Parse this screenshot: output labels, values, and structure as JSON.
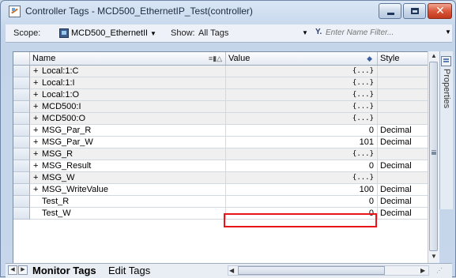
{
  "window": {
    "title": "Controller Tags - MCD500_EthernetIP_Test(controller)",
    "close_glyph": "✕"
  },
  "toolbar": {
    "scope_label": "Scope:",
    "scope_value": "MCD500_EthernetIF",
    "show_label": "Show:",
    "show_value": "All Tags",
    "filter_placeholder": "Enter Name Filter..."
  },
  "grid": {
    "columns": {
      "name": "Name",
      "value": "Value",
      "style": "Style"
    },
    "rows": [
      {
        "expand": "+",
        "name": "Local:1:C",
        "value": "{...}",
        "style": "",
        "struct": true
      },
      {
        "expand": "+",
        "name": "Local:1:I",
        "value": "{...}",
        "style": "",
        "struct": true
      },
      {
        "expand": "+",
        "name": "Local:1:O",
        "value": "{...}",
        "style": "",
        "struct": true
      },
      {
        "expand": "+",
        "name": "MCD500:I",
        "value": "{...}",
        "style": "",
        "struct": true
      },
      {
        "expand": "+",
        "name": "MCD500:O",
        "value": "{...}",
        "style": "",
        "struct": true
      },
      {
        "expand": "+",
        "name": "MSG_Par_R",
        "value": "0",
        "style": "Decimal",
        "struct": false
      },
      {
        "expand": "+",
        "name": "MSG_Par_W",
        "value": "101",
        "style": "Decimal",
        "struct": false
      },
      {
        "expand": "+",
        "name": "MSG_R",
        "value": "{...}",
        "style": "",
        "struct": true
      },
      {
        "expand": "+",
        "name": "MSG_Result",
        "value": "0",
        "style": "Decimal",
        "struct": false
      },
      {
        "expand": "+",
        "name": "MSG_W",
        "value": "{...}",
        "style": "",
        "struct": true
      },
      {
        "expand": "+",
        "name": "MSG_WriteValue",
        "value": "100",
        "style": "Decimal",
        "struct": false,
        "highlighted": true
      },
      {
        "expand": "",
        "name": "Test_R",
        "value": "0",
        "style": "Decimal",
        "struct": false
      },
      {
        "expand": "",
        "name": "Test_W",
        "value": "0",
        "style": "Decimal",
        "struct": false
      }
    ]
  },
  "side_panel": {
    "label": "Properties"
  },
  "tabs": [
    {
      "label": "Monitor Tags",
      "active": true
    },
    {
      "label": "Edit Tags",
      "active": false
    }
  ],
  "colors": {
    "highlight": "#e8141a",
    "struct_row_bg": "#f0f0f0"
  }
}
